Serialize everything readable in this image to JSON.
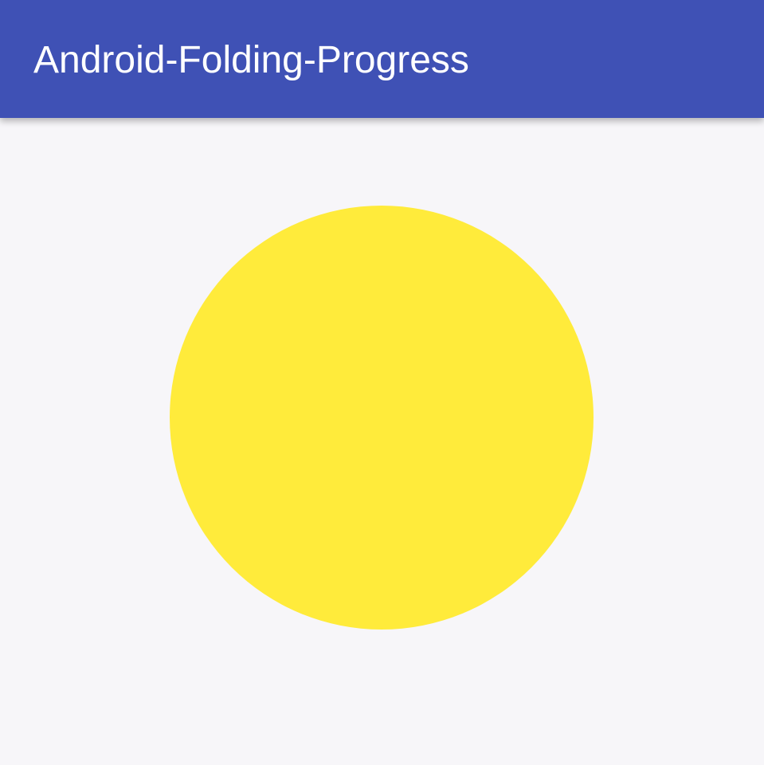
{
  "app_bar": {
    "title": "Android-Folding-Progress"
  },
  "colors": {
    "app_bar": "#3f51b5",
    "background": "#f7f6f9",
    "title_text": "#ffffff",
    "progress_fill": "#ffeb3b"
  },
  "folding_progress": {
    "shape": "circle",
    "state": "fully-unfolded"
  }
}
